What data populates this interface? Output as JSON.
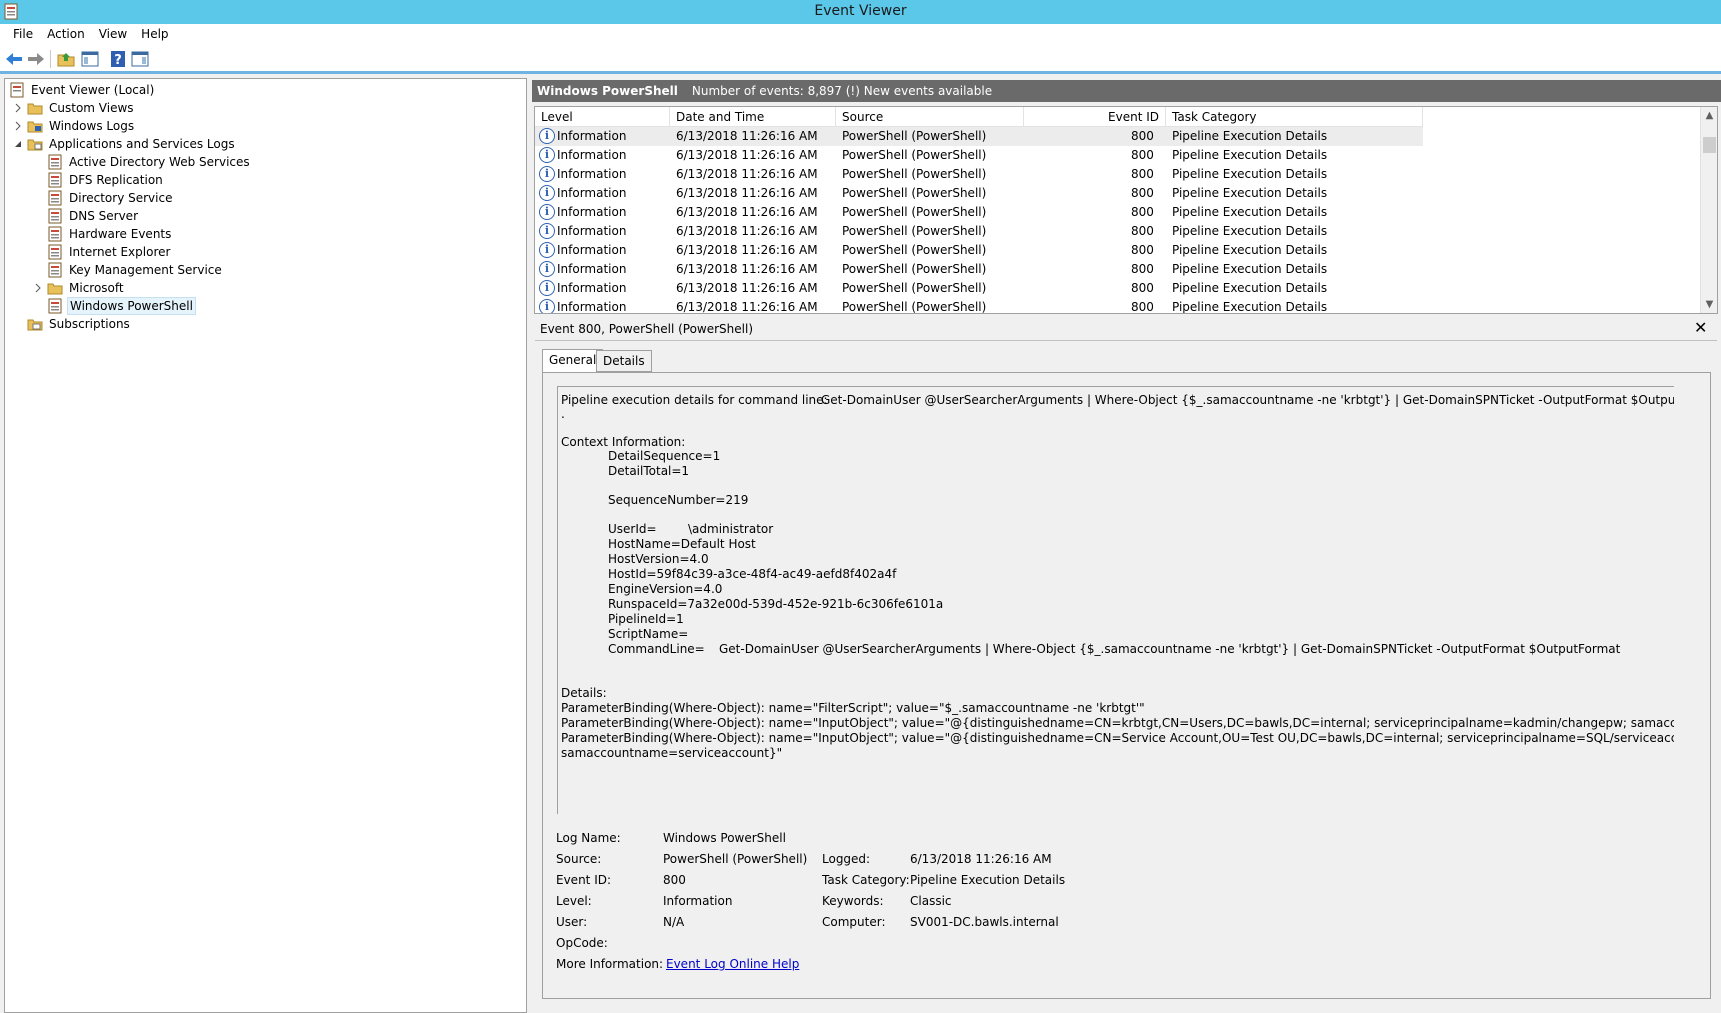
{
  "window": {
    "title": "Event Viewer"
  },
  "menu": [
    "File",
    "Action",
    "View",
    "Help"
  ],
  "tree": {
    "root": "Event Viewer (Local)",
    "custom_views": "Custom Views",
    "windows_logs": "Windows Logs",
    "app_services": "Applications and Services Logs",
    "logs": [
      "Active Directory Web Services",
      "DFS Replication",
      "Directory Service",
      "DNS Server",
      "Hardware Events",
      "Internet Explorer",
      "Key Management Service"
    ],
    "microsoft": "Microsoft",
    "powershell": "Windows PowerShell",
    "subscriptions": "Subscriptions"
  },
  "list": {
    "log_name": "Windows PowerShell",
    "summary": "Number of events: 8,897 (!) New events available",
    "columns": [
      "Level",
      "Date and Time",
      "Source",
      "Event ID",
      "Task Category"
    ],
    "row": {
      "level": "Information",
      "date": "6/13/2018 11:26:16 AM",
      "source": "PowerShell (PowerShell)",
      "event_id": "800",
      "category": "Pipeline Execution Details"
    },
    "row_count_visible": 10
  },
  "preview": {
    "title": "Event 800, PowerShell (PowerShell)",
    "close": "✕",
    "tabs": [
      "General",
      "Details"
    ],
    "description": {
      "line1_label": "Pipeline execution details for command line:",
      "line1_cmd": "Get-DomainUser @UserSearcherArguments | Where-Object {$_.samaccountname -ne 'krbtgt'} | Get-DomainSPNTicket -OutputFormat $OutputFormat",
      "dot": ".",
      "context_hdr": "Context Information:",
      "detail_seq": "DetailSequence=1",
      "detail_total": "DetailTotal=1",
      "seq_num": "SequenceNumber=219",
      "user_id_label": "UserId=",
      "user_id_val": "\\administrator",
      "host_name": "HostName=Default Host",
      "host_version": "HostVersion=4.0",
      "host_id": "HostId=59f84c39-a3ce-48f4-ac49-aefd8f402a4f",
      "engine_version": "EngineVersion=4.0",
      "runspace_id": "RunspaceId=7a32e00d-539d-452e-921b-6c306fe6101a",
      "pipeline_id": "PipelineId=1",
      "script_name": "ScriptName=",
      "cmdline_label": "CommandLine=",
      "cmdline_val": "Get-DomainUser @UserSearcherArguments | Where-Object {$_.samaccountname -ne 'krbtgt'} | Get-DomainSPNTicket -OutputFormat $OutputFormat",
      "details_hdr": "Details:",
      "pb1": "ParameterBinding(Where-Object): name=\"FilterScript\"; value=\"$_.samaccountname -ne 'krbtgt'\"",
      "pb2": "ParameterBinding(Where-Object): name=\"InputObject\"; value=\"@{distinguishedname=CN=krbtgt,CN=Users,DC=bawls,DC=internal; serviceprincipalname=kadmin/changepw; samaccountname=krbtgt}\"",
      "pb3a": "ParameterBinding(Where-Object): name=\"InputObject\"; value=\"@{distinguishedname=CN=Service Account,OU=Test OU,DC=bawls,DC=internal; serviceprincipalname=SQL/serviceaccount;",
      "pb3b": "samaccountname=serviceaccount}\""
    },
    "meta": {
      "log_name_label": "Log Name:",
      "log_name": "Windows PowerShell",
      "source_label": "Source:",
      "source": "PowerShell (PowerShell)",
      "logged_label": "Logged:",
      "logged": "6/13/2018 11:26:16 AM",
      "event_id_label": "Event ID:",
      "event_id": "800",
      "task_label": "Task Category:",
      "task": "Pipeline Execution Details",
      "level_label": "Level:",
      "level": "Information",
      "keywords_label": "Keywords:",
      "keywords": "Classic",
      "user_label": "User:",
      "user": "N/A",
      "computer_label": "Computer:",
      "computer": "SV001-DC.bawls.internal",
      "opcode_label": "OpCode:",
      "more_info_label": "More Information:",
      "more_info_link": "Event Log Online Help"
    }
  },
  "colors": {
    "titlebar": "#5bc8ea",
    "list_header": "#6a6a6a",
    "link": "#0000cc",
    "info_icon": "#2f62b3"
  }
}
